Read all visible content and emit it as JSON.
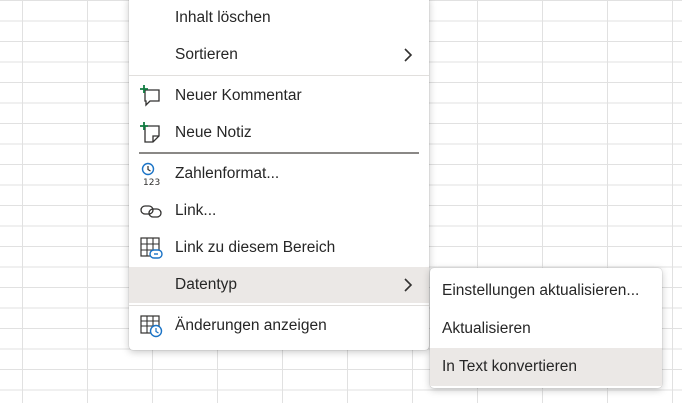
{
  "context_menu": {
    "items": [
      {
        "label": "Inhalt löschen",
        "icon": ""
      },
      {
        "label": "Sortieren",
        "icon": "chevron-right-icon"
      },
      {
        "label": "Neuer Kommentar",
        "icon": "new-comment-icon"
      },
      {
        "label": "Neue Notiz",
        "icon": "new-note-icon"
      },
      {
        "label": "Zahlenformat...",
        "icon": "number-format-icon"
      },
      {
        "label": "Link...",
        "icon": "link-icon"
      },
      {
        "label": "Link zu diesem Bereich",
        "icon": "link-to-range-icon"
      },
      {
        "label": "Datentyp",
        "icon": "chevron-right-icon"
      },
      {
        "label": "Änderungen anzeigen",
        "icon": "show-changes-icon"
      }
    ]
  },
  "submenu": {
    "items": [
      {
        "label": "Einstellungen aktualisieren..."
      },
      {
        "label": "Aktualisieren"
      },
      {
        "label": "In Text konvertieren"
      }
    ]
  },
  "colors": {
    "accent_green": "#107c41",
    "accent_blue": "#1a73c6",
    "hover": "#ebe8e6",
    "grid": "#e1e1e1"
  }
}
